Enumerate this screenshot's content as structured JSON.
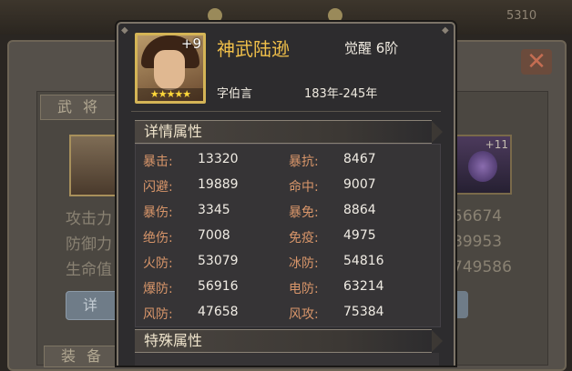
{
  "background": {
    "top_stats": [
      "5310"
    ],
    "tab_general": "武将",
    "tab_equip": "装备",
    "stat_labels": [
      "攻击力",
      "防御力",
      "生命值"
    ],
    "stat_values": [
      "56674",
      "89953",
      "749586"
    ],
    "detail_button": "详",
    "right_item_level": "+11"
  },
  "popup": {
    "hero": {
      "name": "神武陆逊",
      "awaken": "觉醒 6阶",
      "courtesy_name": "字伯言",
      "years": "183年-245年",
      "enhance_level": "+9",
      "stars": "★★★★★"
    },
    "detail_section": {
      "title": "详情属性",
      "attributes": [
        {
          "label": "暴击:",
          "value": "13320"
        },
        {
          "label": "暴抗:",
          "value": "8467"
        },
        {
          "label": "闪避:",
          "value": "19889"
        },
        {
          "label": "命中:",
          "value": "9007"
        },
        {
          "label": "暴伤:",
          "value": "3345"
        },
        {
          "label": "暴免:",
          "value": "8864"
        },
        {
          "label": "绝伤:",
          "value": "7008"
        },
        {
          "label": "免疫:",
          "value": "4975"
        },
        {
          "label": "火防:",
          "value": "53079"
        },
        {
          "label": "冰防:",
          "value": "54816"
        },
        {
          "label": "爆防:",
          "value": "56916"
        },
        {
          "label": "电防:",
          "value": "63214"
        },
        {
          "label": "风防:",
          "value": "47658"
        },
        {
          "label": "风攻:",
          "value": "75384"
        }
      ]
    },
    "special_section": {
      "title": "特殊属性"
    }
  },
  "colors": {
    "accent_gold": "#f1c04a",
    "attr_label": "#d9966a",
    "attr_value": "#f0ece4"
  }
}
